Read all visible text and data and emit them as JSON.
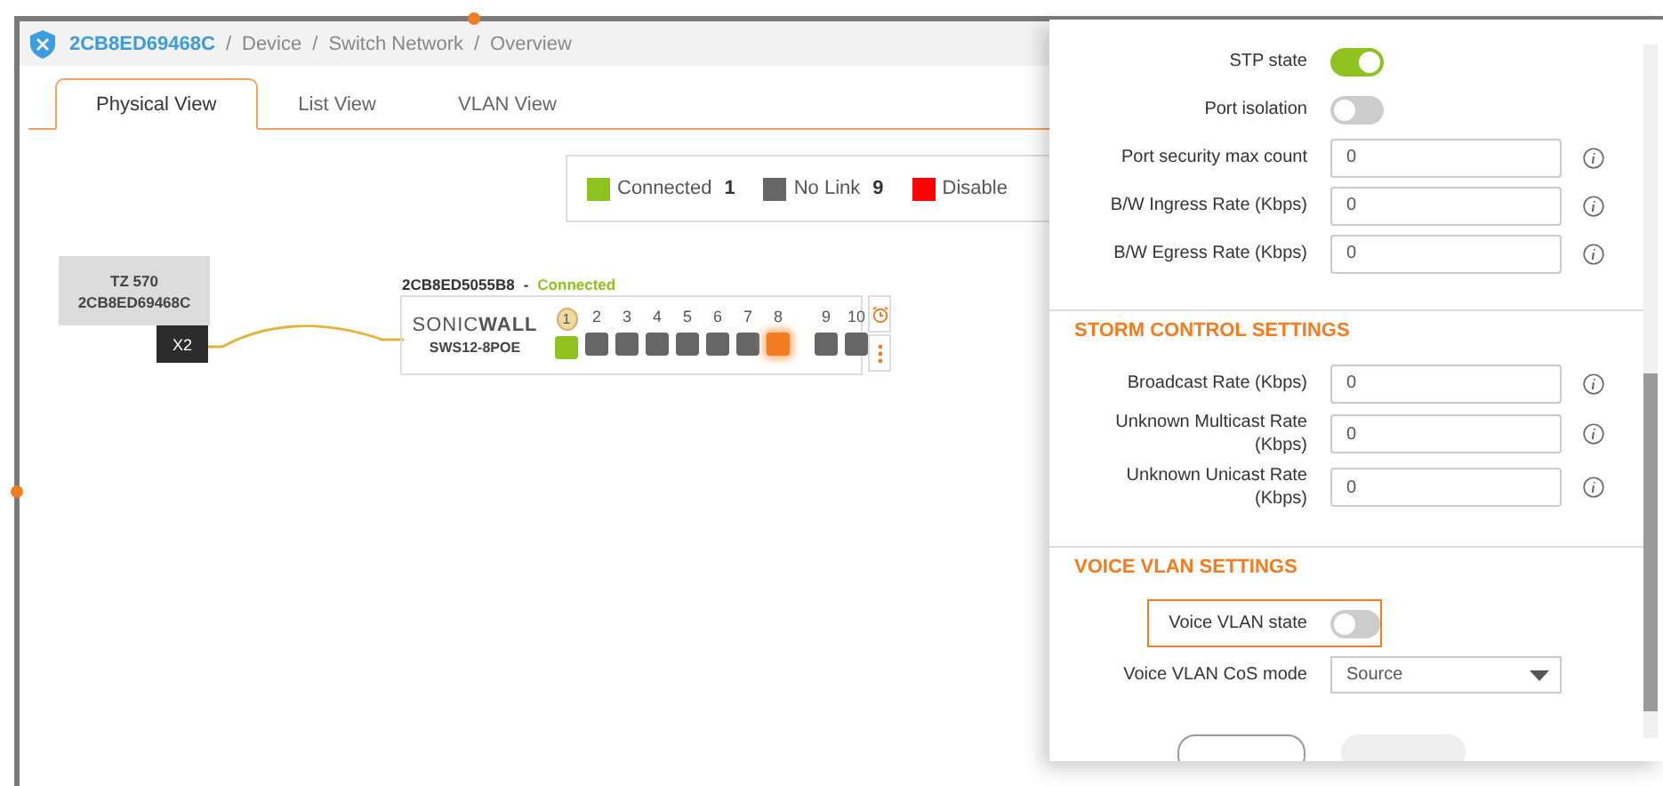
{
  "breadcrumb": {
    "device": "2CB8ED69468C",
    "separator": "/",
    "items": [
      "Device",
      "Switch Network",
      "Overview"
    ]
  },
  "tabs": [
    {
      "label": "Physical View",
      "selected": true
    },
    {
      "label": "List View",
      "selected": false
    },
    {
      "label": "VLAN View",
      "selected": false
    }
  ],
  "legend": [
    {
      "label": "Connected",
      "count": "1",
      "color": "#8dc21f"
    },
    {
      "label": "No Link",
      "count": "9",
      "color": "#666666"
    },
    {
      "label": "Disable",
      "color": "#ff0000"
    }
  ],
  "firewall": {
    "model": "TZ 570",
    "serial": "2CB8ED69468C",
    "port": "X2"
  },
  "switch": {
    "serial": "2CB8ED5055B8",
    "dash": "-",
    "status": "Connected",
    "logo": "SONIC**WALL**",
    "model": "SWS12-8POE",
    "ports": [
      {
        "label": "1",
        "kind": "connected",
        "selected": false,
        "badge": true
      },
      {
        "label": "2",
        "kind": "nolink",
        "selected": false,
        "badge": false
      },
      {
        "label": "3",
        "kind": "nolink",
        "selected": false,
        "badge": false
      },
      {
        "label": "4",
        "kind": "nolink",
        "selected": false,
        "badge": false
      },
      {
        "label": "5",
        "kind": "nolink",
        "selected": false,
        "badge": false
      },
      {
        "label": "6",
        "kind": "nolink",
        "selected": false,
        "badge": false
      },
      {
        "label": "7",
        "kind": "nolink",
        "selected": false,
        "badge": false
      },
      {
        "label": "8",
        "kind": "nolink",
        "selected": true,
        "badge": false
      },
      {
        "label": "9",
        "kind": "nolink",
        "selected": false,
        "badge": false,
        "gap": true
      },
      {
        "label": "10",
        "kind": "nolink",
        "selected": false,
        "badge": false
      }
    ]
  },
  "panel": {
    "sections": [
      {
        "rows": [
          {
            "kind": "toggle",
            "label": "STP state",
            "on": true,
            "highlighted": false
          },
          {
            "kind": "toggle",
            "label": "Port isolation",
            "on": false,
            "highlighted": false
          },
          {
            "kind": "input",
            "label": "Port security max count",
            "value": "0"
          },
          {
            "kind": "input",
            "label": "B/W Ingress Rate (Kbps)",
            "value": "0"
          },
          {
            "kind": "input",
            "label": "B/W Egress Rate (Kbps)",
            "value": "0"
          }
        ]
      },
      {
        "title": "STORM CONTROL SETTINGS",
        "rows": [
          {
            "kind": "input",
            "label": "Broadcast Rate (Kbps)",
            "value": "0"
          },
          {
            "kind": "input",
            "label": "Unknown Multicast Rate (Kbps)",
            "value": "0"
          },
          {
            "kind": "input",
            "label": "Unknown Unicast Rate (Kbps)",
            "value": "0"
          }
        ]
      },
      {
        "title": "VOICE VLAN SETTINGS",
        "rows": [
          {
            "kind": "toggle",
            "label": "Voice VLAN state",
            "on": false,
            "highlighted": true
          },
          {
            "kind": "select",
            "label": "Voice VLAN CoS mode",
            "value": "Source"
          }
        ]
      }
    ]
  }
}
